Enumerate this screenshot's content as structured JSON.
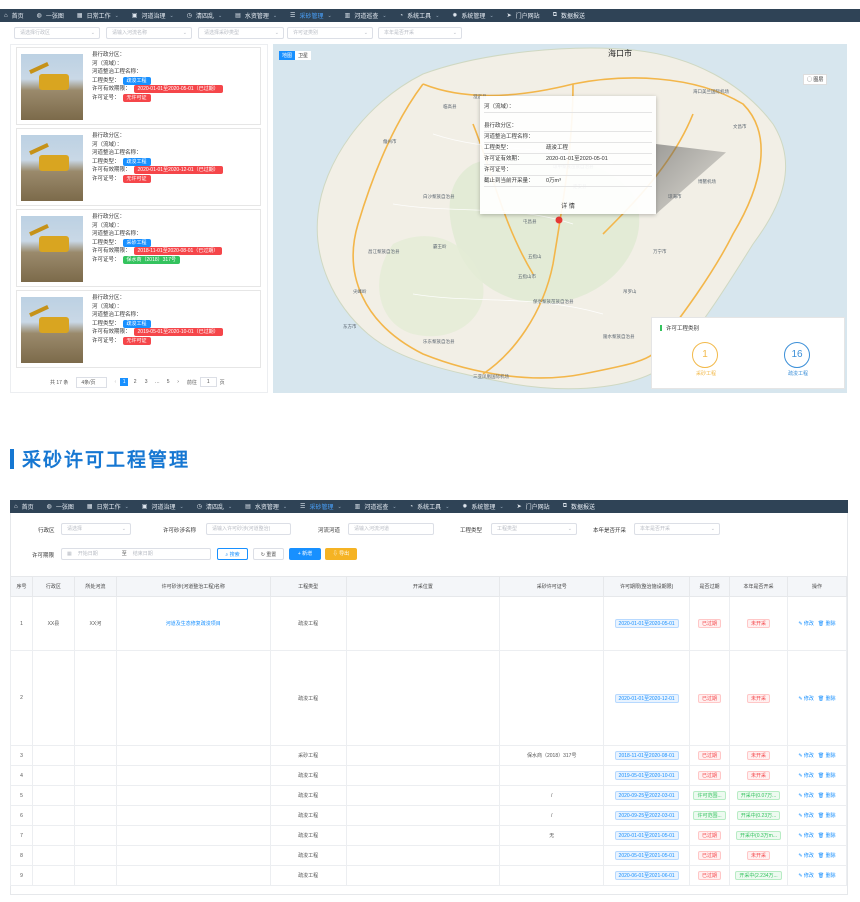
{
  "nav": [
    {
      "icon": "home-icon",
      "glyph": "⌂",
      "label": "首页",
      "active": false,
      "chev": false
    },
    {
      "icon": "globe-icon",
      "glyph": "◍",
      "label": "一张图",
      "active": false,
      "chev": false
    },
    {
      "icon": "grid-icon",
      "glyph": "▦",
      "label": "日常工作",
      "active": false,
      "chev": true
    },
    {
      "icon": "monitor-icon",
      "glyph": "▣",
      "label": "河道治理",
      "active": false,
      "chev": true
    },
    {
      "icon": "clock-icon",
      "glyph": "◷",
      "label": "清四乱",
      "active": false,
      "chev": true
    },
    {
      "icon": "file-icon",
      "glyph": "▤",
      "label": "水资管理",
      "active": false,
      "chev": true
    },
    {
      "icon": "list-icon",
      "glyph": "☰",
      "label": "采砂管理",
      "active": true,
      "chev": true
    },
    {
      "icon": "table-icon",
      "glyph": "▥",
      "label": "河道巡查",
      "active": false,
      "chev": true
    },
    {
      "icon": "tool-icon",
      "glyph": "◔",
      "label": "系统工具",
      "active": false,
      "chev": true
    },
    {
      "icon": "gear-icon",
      "glyph": "✹",
      "label": "系统管理",
      "active": false,
      "chev": true
    },
    {
      "icon": "send-icon",
      "glyph": "➤",
      "label": "门户网站",
      "active": false,
      "chev": false
    },
    {
      "icon": "external-icon",
      "glyph": "⧉",
      "label": "数据报送",
      "active": false,
      "chev": false
    }
  ],
  "top_filters": [
    "请选择行政区",
    "请输入河流名称",
    "请选择采砂类型",
    "许可证类别",
    "本年是否开采"
  ],
  "cards": [
    {
      "l1": "县行政分区：",
      "l2": "河（流域）：",
      "l3": "河道整治工程名称：",
      "type_label": "工程类型：",
      "type_tag": "疏浚工程",
      "period_label": "许可有效期限：",
      "period_tag": "2020-01-01至2020-05-01（已过期）",
      "period_color": "red",
      "cert_label": "许可证号：",
      "cert_tag": "无许可证",
      "cert_color": "red"
    },
    {
      "l1": "县行政分区：",
      "l2": "河（流域）：",
      "l3": "河道整治工程名称：",
      "type_label": "工程类型：",
      "type_tag": "疏浚工程",
      "period_label": "许可有效期限：",
      "period_tag": "2020-01-01至2020-12-01（已过期）",
      "period_color": "red",
      "cert_label": "许可证号：",
      "cert_tag": "无许可证",
      "cert_color": "red"
    },
    {
      "l1": "县行政分区：",
      "l2": "河（流域）：",
      "l3": "河道整治工程名称：",
      "type_label": "工程类型：",
      "type_tag": "采砂工程",
      "period_label": "许可有效期限：",
      "period_tag": "2018-11-01至2020-08-01（已过期）",
      "period_color": "red",
      "cert_label": "许可证号：",
      "cert_tag": "保水商（2018）317号",
      "cert_color": "green"
    },
    {
      "l1": "县行政分区：",
      "l2": "河（流域）：",
      "l3": "河道整治工程名称：",
      "type_label": "工程类型：",
      "type_tag": "疏浚工程",
      "period_label": "许可有效期限：",
      "period_tag": "2019-05-01至2020-10-01（已过期）",
      "period_color": "red",
      "cert_label": "许可证号：",
      "cert_tag": "无许可证",
      "cert_color": "red"
    }
  ],
  "pager": {
    "total": "共 17 条",
    "size": "4条/页",
    "pages": [
      "1",
      "2",
      "3",
      "…",
      "5"
    ],
    "goto": "前往",
    "page": "1",
    "unit": "页"
  },
  "map": {
    "city": "海口市",
    "btn_a": "地图",
    "btn_b": "卫星",
    "legend": "◯ 图层",
    "popup": {
      "rows": [
        {
          "k": "河（流域）：",
          "v": ""
        },
        {
          "k": "县行政分区：",
          "v": ""
        },
        {
          "k": "河道整治工程名称：",
          "v": ""
        },
        {
          "k": "工程类型：",
          "v": "疏浚工程"
        },
        {
          "k": "许可证有效期：",
          "v": "2020-01-01至2020-05-01"
        },
        {
          "k": "许可证号：",
          "v": ""
        },
        {
          "k": "截止到当前开采量：",
          "v": "0万m³"
        }
      ],
      "detail": "详 情"
    },
    "stat": {
      "title": "许可工程类别",
      "a_val": "1",
      "a_lbl": "采砂工程",
      "b_val": "16",
      "b_lbl": "疏浚工程"
    },
    "places": [
      "定安县",
      "屯昌县",
      "琼海市",
      "万宁市",
      "五指山",
      "白沙黎族自治县",
      "昌江黎族自治县",
      "东方市",
      "乐东黎族自治县",
      "陵水黎族自治县",
      "保亭黎族苗族自治县",
      "儋州市",
      "临高县",
      "澄迈县",
      "文昌市",
      "琼中黎族苗族自治县",
      "三亚凤凰国际机场",
      "海口美兰国际机场",
      "博鳌机场",
      "尖峰岭",
      "五指山市",
      "吊罗山",
      "霸王岭"
    ]
  },
  "section_title": "采砂许可工程管理",
  "form": {
    "region_label": "行政区",
    "region_ph": "请选择",
    "name_label": "许可砂涉名称",
    "name_ph": "请输入许可砂涉(河道整治)",
    "river_label": "河流河道",
    "river_ph": "请输入河流河道",
    "type_label": "工程类型",
    "type_ph": "工程类型",
    "year_label": "本年是否开采",
    "year_ph": "本年是否开采",
    "period_label": "许可期限",
    "start_ph": "开始日期",
    "sep": "至",
    "end_ph": "结束日期",
    "search": "⌕ 搜索",
    "reset": "↻ 重置",
    "add": "+ 新增",
    "export": "⇩ 导出"
  },
  "table": {
    "headers": [
      "序号",
      "行政区",
      "所处河流",
      "许可砂涉(河道整治工程)名称",
      "工程类型",
      "开采位置",
      "采砂许可证号",
      "许可期限(整治施设期限)",
      "是否过期",
      "本年是否开采",
      "操作"
    ],
    "edit": "✎ 修改",
    "del": "🗑 删除",
    "rows": [
      {
        "no": "1",
        "region": "XX县",
        "river": "XX河",
        "name": "河道及生态修复疏浚项目",
        "type": "疏浚工程",
        "pos": "",
        "cert": "",
        "period": "2020-01-01至2020-05-01",
        "exp": "已过期",
        "exp_c": "red",
        "year": "未开采",
        "year_c": "red"
      },
      {
        "no": "2",
        "region": "",
        "river": "",
        "name": "",
        "type": "疏浚工程",
        "pos": "",
        "cert": "",
        "period": "2020-01-01至2020-12-01",
        "exp": "已过期",
        "exp_c": "red",
        "year": "未开采",
        "year_c": "red"
      },
      {
        "no": "3",
        "region": "",
        "river": "",
        "name": "",
        "type": "采砂工程",
        "pos": "",
        "cert": "保水商（2018）317号",
        "period": "2018-11-01至2020-08-01",
        "exp": "已过期",
        "exp_c": "red",
        "year": "未开采",
        "year_c": "red"
      },
      {
        "no": "4",
        "region": "",
        "river": "",
        "name": "",
        "type": "疏浚工程",
        "pos": "",
        "cert": "",
        "period": "2019-05-01至2020-10-01",
        "exp": "已过期",
        "exp_c": "red",
        "year": "未开采",
        "year_c": "red"
      },
      {
        "no": "5",
        "region": "",
        "river": "",
        "name": "",
        "type": "疏浚工程",
        "pos": "",
        "cert": "/",
        "period": "2020-09-25至2022-03-01",
        "exp": "许可范围...",
        "exp_c": "green",
        "year": "开采中(0.07万...",
        "year_c": "green"
      },
      {
        "no": "6",
        "region": "",
        "river": "",
        "name": "",
        "type": "疏浚工程",
        "pos": "",
        "cert": "/",
        "period": "2020-09-25至2022-03-01",
        "exp": "许可范围...",
        "exp_c": "green",
        "year": "开采中(0.23万...",
        "year_c": "green"
      },
      {
        "no": "7",
        "region": "",
        "river": "",
        "name": "",
        "type": "疏浚工程",
        "pos": "",
        "cert": "无",
        "period": "2020-01-01至2021-05-01",
        "exp": "已过期",
        "exp_c": "red",
        "year": "开采中(0.3万m...",
        "year_c": "green"
      },
      {
        "no": "8",
        "region": "",
        "river": "",
        "name": "",
        "type": "疏浚工程",
        "pos": "",
        "cert": "",
        "period": "2020-05-01至2021-05-01",
        "exp": "已过期",
        "exp_c": "red",
        "year": "未开采",
        "year_c": "red"
      },
      {
        "no": "9",
        "region": "",
        "river": "",
        "name": "",
        "type": "疏浚工程",
        "pos": "",
        "cert": "",
        "period": "2020-06-01至2021-06-01",
        "exp": "已过期",
        "exp_c": "red",
        "year": "开采中(2.234万...",
        "year_c": "green"
      }
    ]
  }
}
